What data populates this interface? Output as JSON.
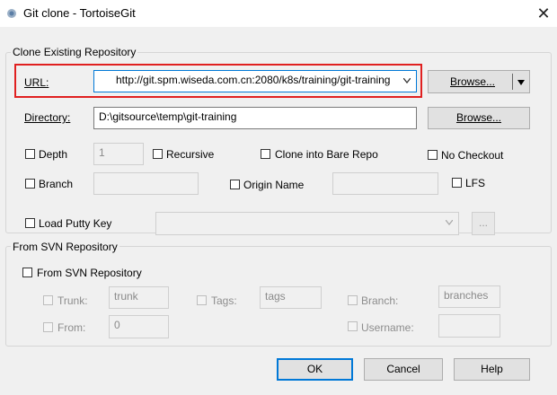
{
  "window": {
    "title": "Git clone - TortoiseGit",
    "close_glyph": "✕"
  },
  "clone_group": {
    "title": "Clone Existing Repository",
    "url_label": "URL:",
    "url_value": "http://git.spm.wiseda.com.cn:2080/k8s/training/git-training",
    "url_browse": "Browse...",
    "directory_label": "Directory:",
    "directory_value": "D:\\gitsource\\temp\\git-training",
    "directory_browse": "Browse...",
    "depth_label": "Depth",
    "depth_value": "1",
    "recursive_label": "Recursive",
    "bare_label": "Clone into Bare Repo",
    "nocheckout_label": "No Checkout",
    "branch_label": "Branch",
    "origin_label": "Origin Name",
    "lfs_label": "LFS"
  },
  "putty": {
    "label": "Load Putty Key",
    "ellipsis": "..."
  },
  "svn_group": {
    "title": "From SVN Repository",
    "checkbox_label": "From SVN Repository",
    "trunk_label": "Trunk:",
    "trunk_value": "trunk",
    "tags_label": "Tags:",
    "tags_value": "tags",
    "branch_label": "Branch:",
    "branches_value": "branches",
    "from_label": "From:",
    "from_value": "0",
    "username_label": "Username:"
  },
  "buttons": {
    "ok": "OK",
    "cancel": "Cancel",
    "help": "Help"
  },
  "colors": {
    "highlight": "#e02020",
    "default_button_border": "#0078d7"
  }
}
